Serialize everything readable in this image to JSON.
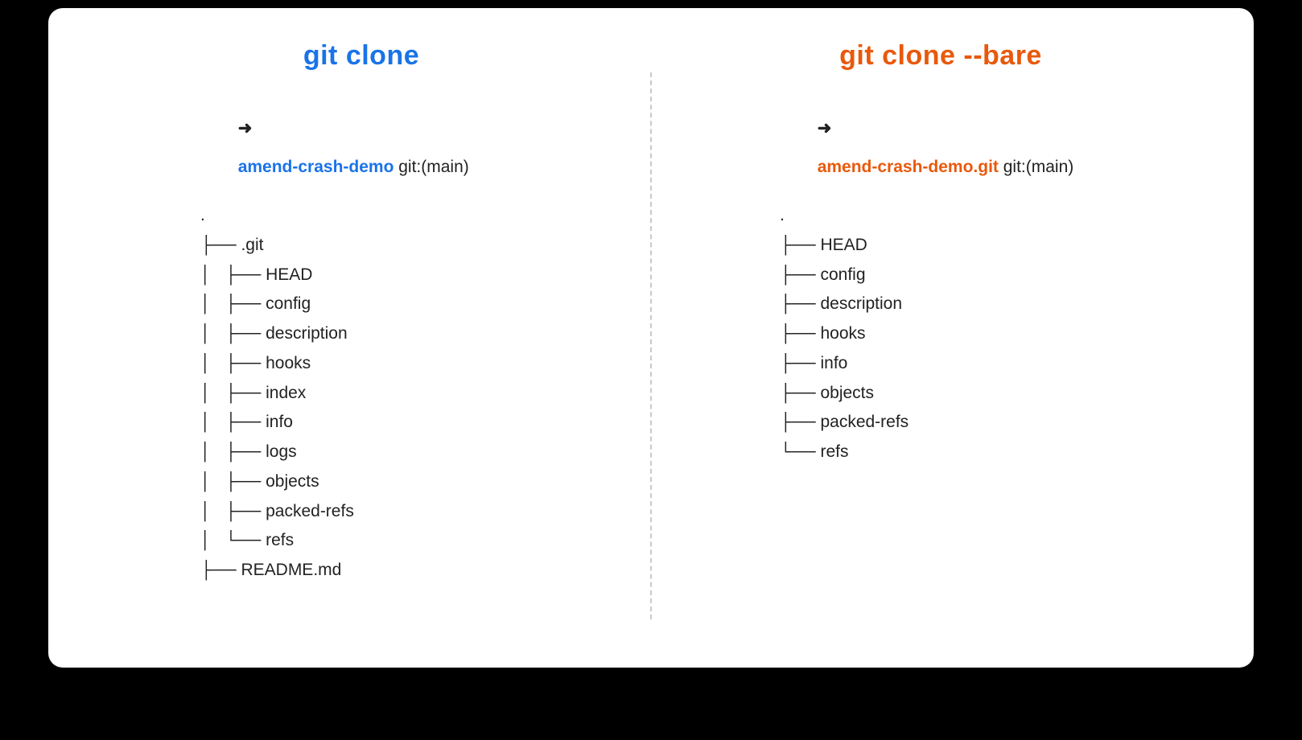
{
  "left": {
    "heading": "git clone",
    "prompt_arrow": "➜",
    "prompt_name": "amend-crash-demo",
    "prompt_rest": " git:(main)",
    "tree_lines": [
      ".",
      "├── .git",
      "│   ├── HEAD",
      "│   ├── config",
      "│   ├── description",
      "│   ├── hooks",
      "│   ├── index",
      "│   ├── info",
      "│   ├── logs",
      "│   ├── objects",
      "│   ├── packed-refs",
      "│   └── refs",
      "├── README.md"
    ]
  },
  "right": {
    "heading": "git clone  --bare",
    "prompt_arrow": "➜",
    "prompt_name": "amend-crash-demo.git",
    "prompt_rest": " git:(main)",
    "tree_lines": [
      ".",
      "├── HEAD",
      "├── config",
      "├── description",
      "├── hooks",
      "├── info",
      "├── objects",
      "├── packed-refs",
      "└── refs"
    ]
  }
}
